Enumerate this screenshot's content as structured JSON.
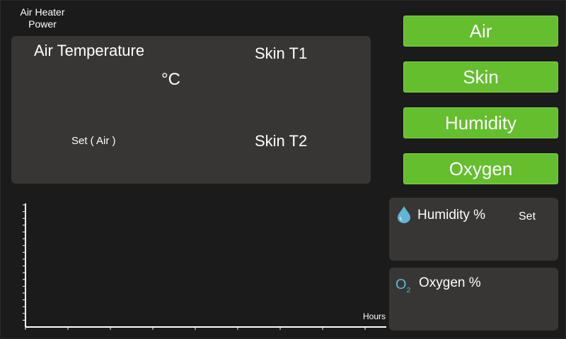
{
  "header": {
    "heater_line1": "Air Heater",
    "heater_line2": "Power"
  },
  "temperature_panel": {
    "air_temperature_label": "Air Temperature",
    "unit": "°C",
    "set_label": "Set ( Air )",
    "skin_t1_label": "Skin T1",
    "skin_t2_label": "Skin T2"
  },
  "nav_buttons": {
    "air": "Air",
    "skin": "Skin",
    "humidity": "Humidity",
    "oxygen": "Oxygen"
  },
  "humidity_panel": {
    "label": "Humidity %",
    "set_label": "Set",
    "icon": "water-drop-icon"
  },
  "oxygen_panel": {
    "label": "Oxygen %",
    "icon_text": "O",
    "icon_sub": "2"
  },
  "graph": {
    "x_axis_label": "Hours",
    "y_ticks": 18,
    "x_ticks": 9
  },
  "colors": {
    "button_green": "#64be2e",
    "panel": "#383635",
    "background": "#1b1b1b",
    "icon_blue": "#5fb6d6"
  }
}
